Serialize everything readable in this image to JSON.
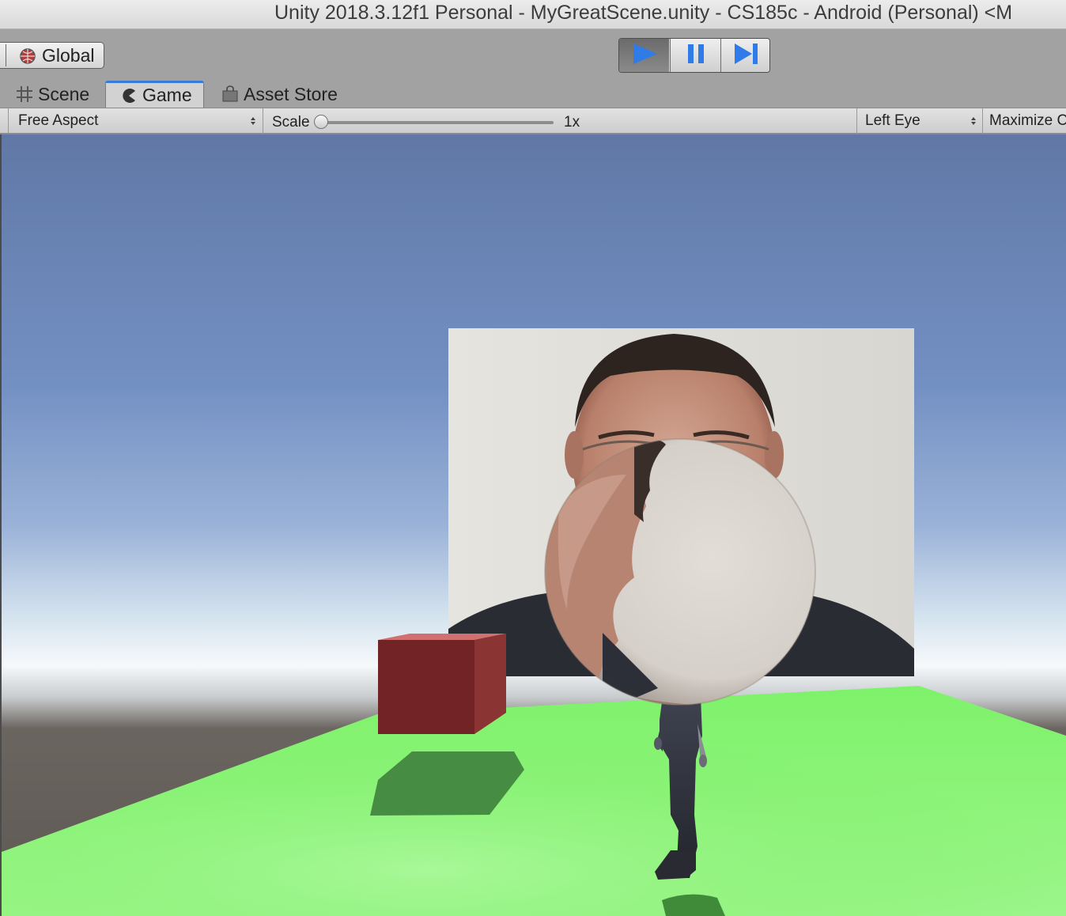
{
  "window": {
    "title": "Unity 2018.3.12f1 Personal - MyGreatScene.unity - CS185c - Android (Personal) <M"
  },
  "toolbar": {
    "global_label": "Global",
    "playback": {
      "play_active": true,
      "buttons": [
        "play",
        "pause",
        "step"
      ]
    }
  },
  "tabs": [
    {
      "label": "Scene",
      "icon": "grid-icon",
      "active": false
    },
    {
      "label": "Game",
      "icon": "pacman-icon",
      "active": true
    },
    {
      "label": "Asset Store",
      "icon": "shopping-bag-icon",
      "active": false
    }
  ],
  "gamebar": {
    "aspect": "Free Aspect",
    "scale_label": "Scale",
    "scale_value": "1x",
    "eye": "Left Eye",
    "maximize": "Maximize C"
  },
  "scene": {
    "colors": {
      "sky_top": "#6279a8",
      "sky_horizon": "#f4f8fb",
      "ground_plane": "#86f07a",
      "far_ground": "#6a625d",
      "cube": "#722325",
      "shadow": "#468c42"
    },
    "objects": [
      "red-cube",
      "photo-billboard",
      "textured-sphere",
      "humanoid-character"
    ]
  }
}
